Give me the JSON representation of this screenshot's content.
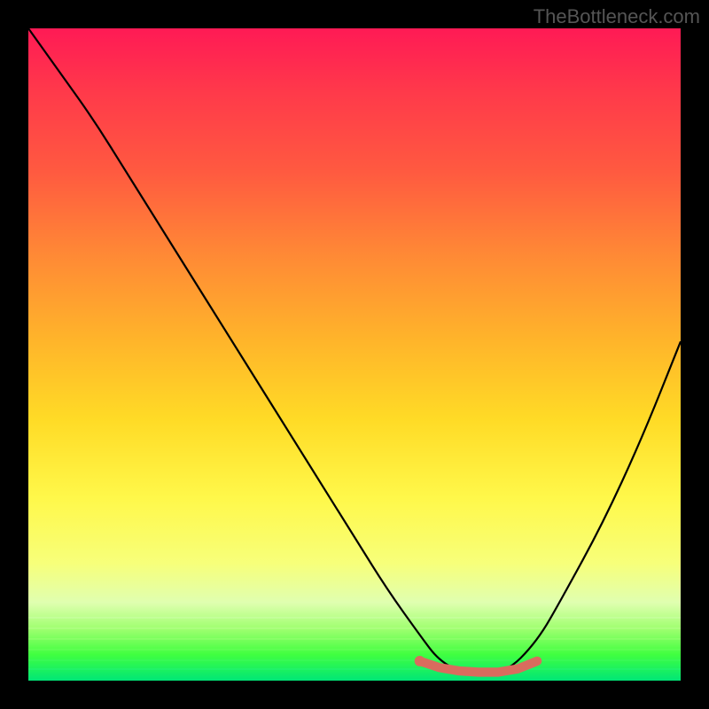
{
  "watermark": "TheBottleneck.com",
  "chart_data": {
    "type": "line",
    "title": "",
    "xlabel": "",
    "ylabel": "",
    "xlim": [
      0,
      100
    ],
    "ylim": [
      0,
      100
    ],
    "series": [
      {
        "name": "bottleneck-curve",
        "x": [
          0,
          5,
          10,
          15,
          20,
          25,
          30,
          35,
          40,
          45,
          50,
          55,
          60,
          63,
          67,
          73,
          78,
          82,
          88,
          94,
          100
        ],
        "values": [
          100,
          93,
          86,
          78,
          70,
          62,
          54,
          46,
          38,
          30,
          22,
          14,
          7,
          3,
          1,
          1,
          6,
          13,
          24,
          37,
          52
        ]
      }
    ],
    "highlight": {
      "name": "optimal-range",
      "x": [
        60,
        63,
        66,
        69,
        72,
        75,
        78
      ],
      "values": [
        3,
        2,
        1.5,
        1.3,
        1.3,
        1.8,
        3
      ],
      "color": "#d96c5e"
    },
    "gradient": {
      "top": "#ff1a55",
      "mid1": "#ff8a35",
      "mid2": "#fff84a",
      "bottom": "#00e676"
    }
  }
}
